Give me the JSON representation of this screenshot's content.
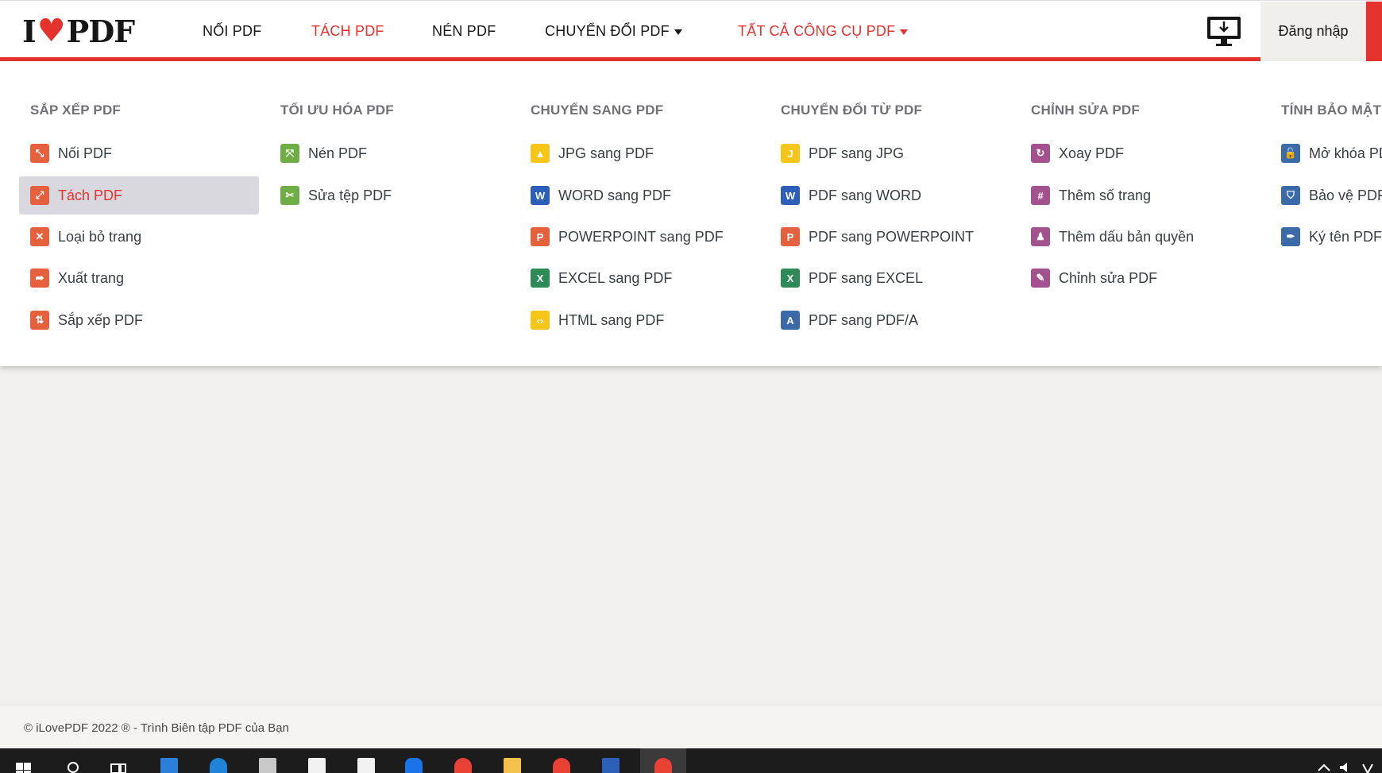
{
  "header": {
    "logo_left": "I",
    "logo_right": "PDF",
    "nav": [
      {
        "label": "NỐI PDF"
      },
      {
        "label": "TÁCH PDF"
      },
      {
        "label": "NÉN PDF"
      },
      {
        "label": "CHUYỂN ĐỔI PDF"
      },
      {
        "label": "TẤT CẢ CÔNG CỤ PDF"
      }
    ],
    "login_label": "Đăng nhập"
  },
  "menu": {
    "columns": [
      {
        "title": "SẮP XẾP PDF",
        "items": [
          {
            "label": "Nối PDF",
            "icon": "merge-icon",
            "color": "#e5613d"
          },
          {
            "label": "Tách PDF",
            "icon": "split-icon",
            "color": "#e5613d",
            "active": true
          },
          {
            "label": "Loại bỏ trang",
            "icon": "remove-icon",
            "color": "#e5613d"
          },
          {
            "label": "Xuất trang",
            "icon": "extract-icon",
            "color": "#e5613d"
          },
          {
            "label": "Sắp xếp PDF",
            "icon": "organize-icon",
            "color": "#e5613d"
          }
        ]
      },
      {
        "title": "TỐI ƯU HÓA PDF",
        "items": [
          {
            "label": "Nén PDF",
            "icon": "compress-icon",
            "color": "#6fae45"
          },
          {
            "label": "Sửa tệp PDF",
            "icon": "repair-icon",
            "color": "#6fae45"
          }
        ]
      },
      {
        "title": "CHUYỂN SANG PDF",
        "items": [
          {
            "label": "JPG sang PDF",
            "icon": "jpg-to-pdf-icon",
            "color": "#f5c518"
          },
          {
            "label": "WORD sang PDF",
            "icon": "word-to-pdf-icon",
            "color": "#2b5fb8"
          },
          {
            "label": "POWERPOINT sang PDF",
            "icon": "ppt-to-pdf-icon",
            "color": "#e5613d"
          },
          {
            "label": "EXCEL sang PDF",
            "icon": "excel-to-pdf-icon",
            "color": "#2e8b57"
          },
          {
            "label": "HTML sang PDF",
            "icon": "html-to-pdf-icon",
            "color": "#f5c518"
          }
        ]
      },
      {
        "title": "CHUYỂN ĐỔI TỪ PDF",
        "items": [
          {
            "label": "PDF sang JPG",
            "icon": "pdf-to-jpg-icon",
            "color": "#f5c518"
          },
          {
            "label": "PDF sang WORD",
            "icon": "pdf-to-word-icon",
            "color": "#2b5fb8"
          },
          {
            "label": "PDF sang POWERPOINT",
            "icon": "pdf-to-ppt-icon",
            "color": "#e5613d"
          },
          {
            "label": "PDF sang EXCEL",
            "icon": "pdf-to-excel-icon",
            "color": "#2e8b57"
          },
          {
            "label": "PDF sang PDF/A",
            "icon": "pdf-to-pdfa-icon",
            "color": "#3b6aa8"
          }
        ]
      },
      {
        "title": "CHỈNH SỬA PDF",
        "items": [
          {
            "label": "Xoay PDF",
            "icon": "rotate-icon",
            "color": "#a3528f"
          },
          {
            "label": "Thêm số trang",
            "icon": "page-numbers-icon",
            "color": "#a3528f"
          },
          {
            "label": "Thêm dấu bản quyền",
            "icon": "watermark-icon",
            "color": "#a3528f"
          },
          {
            "label": "Chỉnh sửa PDF",
            "icon": "edit-icon",
            "color": "#a3528f"
          }
        ]
      },
      {
        "title": "TÍNH BẢO MẬT",
        "items": [
          {
            "label": "Mở khóa PDF",
            "icon": "unlock-icon",
            "color": "#3b6aa8"
          },
          {
            "label": "Bảo vệ PDF",
            "icon": "protect-icon",
            "color": "#3b6aa8"
          },
          {
            "label": "Ký tên PDF",
            "icon": "sign-icon",
            "color": "#3b6aa8"
          }
        ]
      }
    ]
  },
  "footer": {
    "text": "© iLovePDF 2022 ® - Trình Biên tập PDF của Bạn"
  }
}
